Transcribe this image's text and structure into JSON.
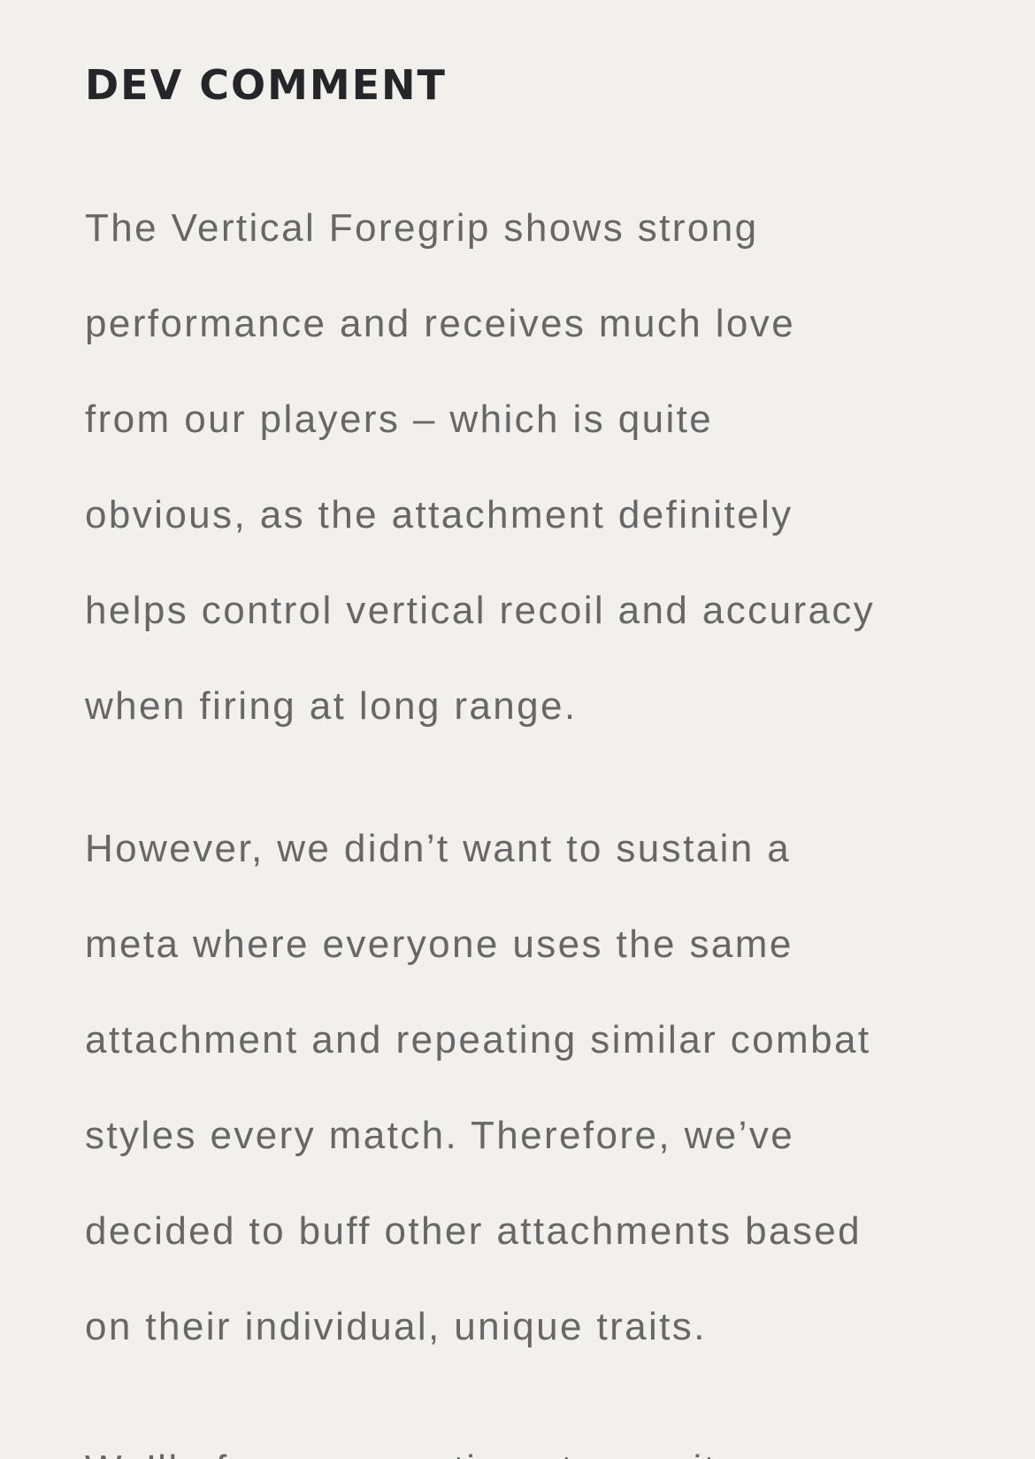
{
  "article": {
    "heading": "DEV COMMENT",
    "paragraph_1": {
      "lines": [
        "The Vertical Foregrip shows strong",
        "performance and receives much love",
        "from our players – which is quite",
        "obvious, as the attachment definitely",
        "helps control vertical recoil and accuracy",
        "when firing at long range."
      ]
    },
    "paragraph_2": {
      "lines": [
        "However, we didn’t want to sustain a",
        "meta where everyone uses the same",
        "attachment and repeating similar combat",
        "styles every match. Therefore, we’ve",
        "decided to buff other attachments based",
        "on their individual, unique traits."
      ]
    },
    "paragraph_3": {
      "lines": [
        "We’ll of course continue to monitor"
      ]
    }
  },
  "colors": {
    "background": "#f1f0ec",
    "heading": "#26262a",
    "body_text": "#676767"
  }
}
